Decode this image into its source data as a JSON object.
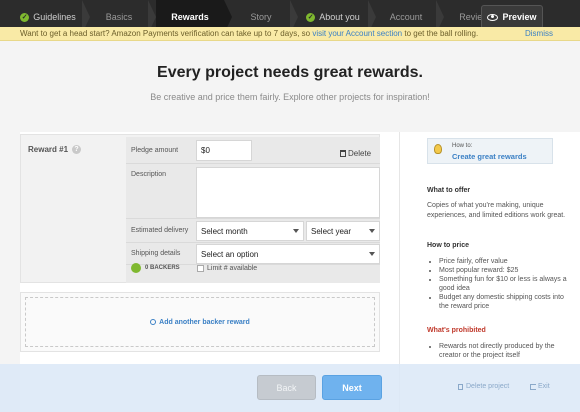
{
  "nav": {
    "steps": [
      {
        "label": "Guidelines",
        "done": true
      },
      {
        "label": "Basics",
        "done": false
      },
      {
        "label": "Rewards",
        "done": false,
        "active": true
      },
      {
        "label": "Story",
        "done": false
      },
      {
        "label": "About you",
        "done": true
      },
      {
        "label": "Account",
        "done": false
      },
      {
        "label": "Review",
        "done": false
      }
    ],
    "preview_label": "Preview"
  },
  "notice": {
    "message": "Want to get a head start? Amazon Payments verification can take up to 7 days, so ",
    "link": "visit your Account section",
    "tail": " to get the ball rolling.",
    "dismiss": "Dismiss"
  },
  "hero": {
    "title": "Every project needs great rewards.",
    "subtitle": "Be creative and price them fairly. Explore other projects for inspiration!"
  },
  "reward": {
    "label": "Reward #1",
    "pledge_label": "Pledge amount",
    "pledge_value": "$0",
    "delete_label": "Delete",
    "description_label": "Description",
    "delivery_label": "Estimated delivery",
    "month_value": "Select month",
    "year_value": "Select year",
    "shipping_label": "Shipping details",
    "shipping_value": "Select an option",
    "backers_label": "0 BACKERS",
    "limit_label": "Limit # available"
  },
  "add_reward_label": "Add another backer reward",
  "sidebar": {
    "howto_small": "How to:",
    "howto_link": "Create great rewards",
    "offer_heading": "What to offer",
    "offer_text": "Copies of what you're making, unique experiences, and limited editions work great.",
    "price_heading": "How to price",
    "price_items": [
      "Price fairly, offer value",
      "Most popular reward: $25",
      "Something fun for $10 or less is always a good idea",
      "Budget any domestic shipping costs into the reward price"
    ],
    "prohibited_heading": "What's prohibited",
    "prohibited_items": [
      "Rewards not directly produced by the creator or the project itself"
    ]
  },
  "footer": {
    "back_label": "Back",
    "next_label": "Next",
    "delete_project_label": "Delete project",
    "exit_label": "Exit"
  }
}
